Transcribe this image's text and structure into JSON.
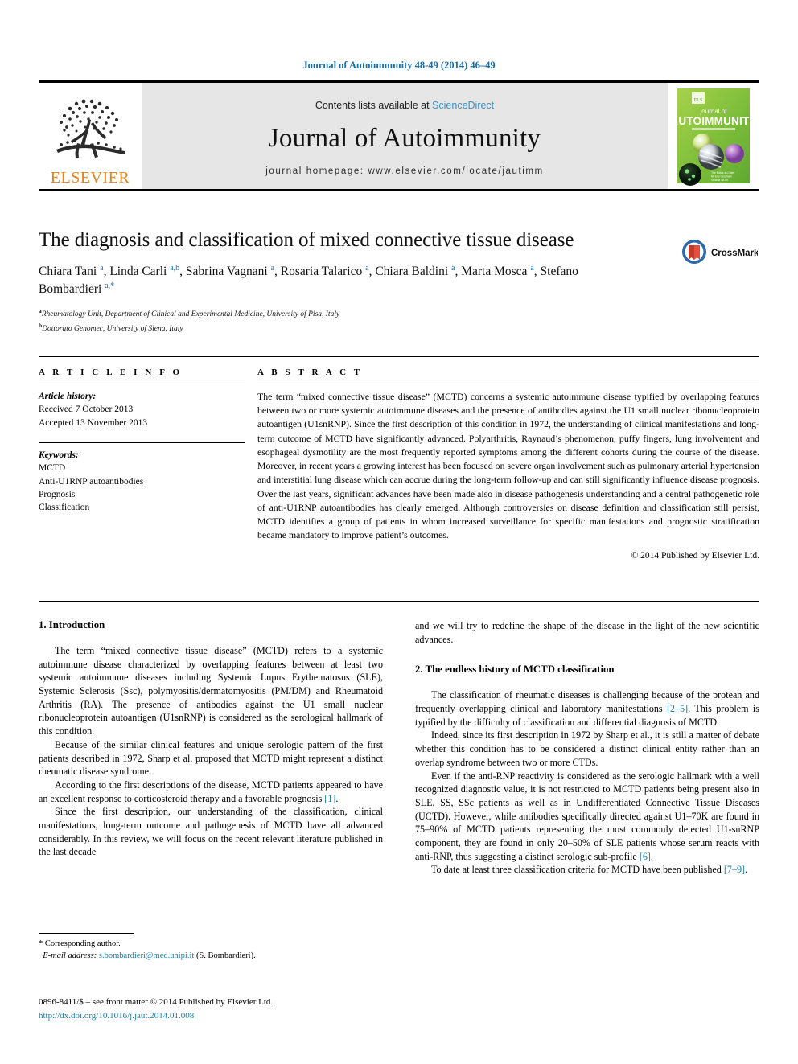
{
  "running_head": "Journal of Autoimmunity 48-49 (2014) 46–49",
  "masthead": {
    "publisher_name": "ELSEVIER",
    "contents_prefix": "Contents lists available at ",
    "contents_link": "ScienceDirect",
    "journal_name": "Journal of Autoimmunity",
    "homepage": "journal homepage: www.elsevier.com/locate/jautimm",
    "cover_title_small": "journal of",
    "cover_title_large": "AUTOIMMUNITY",
    "cover_bg": "#8DC63F"
  },
  "article": {
    "title": "The diagnosis and classification of mixed connective tissue disease",
    "authors_html": "Chiara Tani <sup>a</sup>, Linda Carli <sup>a,b</sup>, Sabrina Vagnani <sup>a</sup>, Rosaria Talarico <sup>a</sup>, Chiara Baldini <sup>a</sup>, Marta Mosca <sup>a</sup>, Stefano Bombardieri <sup>a,*</sup>",
    "affiliation_a": "Rheumatology Unit, Department of Clinical and Experimental Medicine, University of Pisa, Italy",
    "affiliation_b": "Dottorato Genomec, University of Siena, Italy",
    "crossmark_label": "CrossMark"
  },
  "article_info": {
    "heading": "A R T I C L E   I N F O",
    "history_label": "Article history:",
    "received": "Received 7 October 2013",
    "accepted": "Accepted 13 November 2013",
    "keywords_label": "Keywords:",
    "keywords": [
      "MCTD",
      "Anti-U1RNP autoantibodies",
      "Prognosis",
      "Classification"
    ]
  },
  "abstract": {
    "heading": "A B S T R A C T",
    "text": "The term “mixed connective tissue disease” (MCTD) concerns a systemic autoimmune disease typified by overlapping features between two or more systemic autoimmune diseases and the presence of antibodies against the U1 small nuclear ribonucleoprotein autoantigen (U1snRNP). Since the first description of this condition in 1972, the understanding of clinical manifestations and long-term outcome of MCTD have significantly advanced. Polyarthritis, Raynaud’s phenomenon, puffy fingers, lung involvement and esophageal dysmotility are the most frequently reported symptoms among the different cohorts during the course of the disease. Moreover, in recent years a growing interest has been focused on severe organ involvement such as pulmonary arterial hypertension and interstitial lung disease which can accrue during the long-term follow-up and can still significantly influence disease prognosis. Over the last years, significant advances have been made also in disease pathogenesis understanding and a central pathogenetic role of anti-U1RNP autoantibodies has clearly emerged. Although controversies on disease definition and classification still persist, MCTD identifies a group of patients in whom increased surveillance for specific manifestations and prognostic stratification became mandatory to improve patient’s outcomes.",
    "copyright": "© 2014 Published by Elsevier Ltd."
  },
  "body": {
    "left": {
      "section1_heading": "1. Introduction",
      "p1": "The term “mixed connective tissue disease” (MCTD) refers to a systemic autoimmune disease characterized by overlapping features between at least two systemic autoimmune diseases including Systemic Lupus Erythematosus (SLE), Systemic Sclerosis (Ssc), polymyositis/dermatomyositis (PM/DM) and Rheumatoid Arthritis (RA). The presence of antibodies against the U1 small nuclear ribonucleoprotein autoantigen (U1snRNP) is considered as the serological hallmark of this condition.",
      "p2": "Because of the similar clinical features and unique serologic pattern of the first patients described in 1972, Sharp et al. proposed that MCTD might represent a distinct rheumatic disease syndrome.",
      "p3_pre": "According to the first descriptions of the disease, MCTD patients appeared to have an excellent response to corticosteroid therapy and a favorable prognosis ",
      "p3_ref": "[1]",
      "p3_post": ".",
      "p4": "Since the first description, our understanding of the classification, clinical manifestations, long-term outcome and pathogenesis of MCTD have all advanced considerably. In this review, we will focus on the recent relevant literature published in the last decade"
    },
    "right": {
      "p0": "and we will try to redefine the shape of the disease in the light of the new scientific advances.",
      "section2_heading": "2. The endless history of MCTD classification",
      "p1_pre": "The classification of rheumatic diseases is challenging because of the protean and frequently overlapping clinical and laboratory manifestations ",
      "p1_ref": "[2–5]",
      "p1_post": ". This problem is typified by the difficulty of classification and differential diagnosis of MCTD.",
      "p2": "Indeed, since its first description in 1972 by Sharp et al., it is still a matter of debate whether this condition has to be considered a distinct clinical entity rather than an overlap syndrome between two or more CTDs.",
      "p3_pre": "Even if the anti-RNP reactivity is considered as the serologic hallmark with a well recognized diagnostic value, it is not restricted to MCTD patients being present also in SLE, SS, SSc patients as well as in Undifferentiated Connective Tissue Diseases (UCTD). However, while antibodies specifically directed against U1–70K are found in 75–90% of MCTD patients representing the most commonly detected U1-snRNP component, they are found in only 20–50% of SLE patients whose serum reacts with anti-RNP, thus suggesting a distinct serologic sub-profile ",
      "p3_ref": "[6]",
      "p3_post": ".",
      "p4_pre": "To date at least three classification criteria for MCTD have been published ",
      "p4_ref": "[7–9]",
      "p4_post": "."
    }
  },
  "footnote": {
    "corresponding": "* Corresponding author.",
    "email_label": "E-mail address:",
    "email": "s.bombardieri@med.unipi.it",
    "email_suffix": "(S. Bombardieri)."
  },
  "footer": {
    "front_matter": "0896-8411/$ – see front matter © 2014 Published by Elsevier Ltd.",
    "doi": "http://dx.doi.org/10.1016/j.jaut.2014.01.008"
  },
  "colors": {
    "link": "#1a7fae",
    "running_head": "#1a6ea8",
    "elsevier_orange": "#E8821A",
    "band_gray": "#e6e6e6"
  }
}
